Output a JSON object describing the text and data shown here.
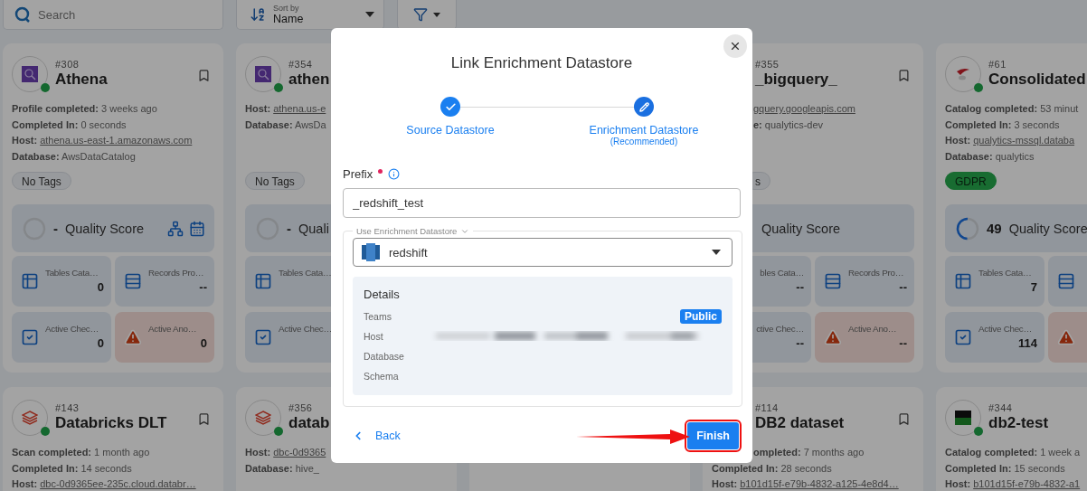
{
  "toolbar": {
    "search": {
      "placeholder": "Search"
    },
    "sort": {
      "label": "Sort by",
      "value": "Name"
    }
  },
  "cards": [
    {
      "number": "#308",
      "name": "Athena",
      "logo": {
        "kind": "athena"
      },
      "online": true,
      "bookmark": true,
      "lines": [
        {
          "label": "Profile completed:",
          "value": "3 weeks ago",
          "link": false
        },
        {
          "label": "Completed In:",
          "value": "0 seconds",
          "link": false
        },
        {
          "label": "Host:",
          "value": "athena.us-east-1.amazonaws.com",
          "link": true
        },
        {
          "label": "Database:",
          "value": "AwsDataCatalog",
          "link": false
        }
      ],
      "tags": [
        {
          "text": "No Tags",
          "kind": "empty"
        }
      ],
      "quality": {
        "score": "-",
        "label": "Quality Score",
        "icons": [
          {
            "kind": "hierarchy"
          },
          {
            "kind": "calendar"
          }
        ]
      },
      "stats": [
        {
          "kind": "tables",
          "label": "Tables Cata…",
          "value": "0"
        },
        {
          "kind": "records",
          "label": "Records Pro…",
          "value": "--"
        },
        {
          "kind": "checks",
          "label": "Active Chec…",
          "value": "0"
        },
        {
          "kind": "anomalies",
          "label": "Active Ano…",
          "value": "0"
        }
      ]
    },
    {
      "number": "#354",
      "name": "athen",
      "logo": {
        "kind": "athena"
      },
      "online": true,
      "lines": [
        {
          "label": "Host:",
          "value": "athena.us-e",
          "link": true
        },
        {
          "label": "Database:",
          "value": "AwsDa",
          "link": false
        }
      ],
      "tags": [
        {
          "text": "No Tags",
          "kind": "empty"
        }
      ],
      "quality": {
        "score": "-",
        "label": "Quali"
      },
      "stats": [
        {
          "kind": "tables",
          "label": "Tables Cata…"
        },
        {
          "kind": "checks",
          "label": "Active Chec…"
        }
      ]
    },
    {
      "number": "#355",
      "name": "_bigquery_",
      "bookmark": true,
      "lines": [
        {
          "value": "gquery.googleapis.com",
          "link": true
        },
        {
          "label": "e:",
          "value": "qualytics-dev",
          "link": false
        }
      ],
      "tags": [
        {
          "text": "s",
          "kind": "empty"
        }
      ],
      "quality": {
        "label": "Quality Score"
      },
      "stats": [
        {
          "kind": "tables",
          "label": "bles Cata…",
          "value": "--"
        },
        {
          "kind": "records",
          "label": "Records Pro…",
          "value": "--"
        },
        {
          "kind": "checks",
          "label": "ctive Chec…",
          "value": "--"
        },
        {
          "kind": "anomalies",
          "label": "Active Ano…",
          "value": "--"
        }
      ]
    },
    {
      "number": "#61",
      "name": "Consolidated",
      "logo": {
        "kind": "mssql"
      },
      "online": true,
      "lines": [
        {
          "label": "Catalog completed:",
          "value": "53 minut",
          "link": false
        },
        {
          "label": "Completed In:",
          "value": "3 seconds",
          "link": false
        },
        {
          "label": "Host:",
          "value": "qualytics-mssql.databa",
          "link": true
        },
        {
          "label": "Database:",
          "value": "qualytics",
          "link": false
        }
      ],
      "tags": [
        {
          "text": "GDPR",
          "kind": "tag"
        }
      ],
      "quality": {
        "score": "49",
        "label": "Quality Score",
        "level": 0.49
      },
      "stats": [
        {
          "kind": "tables",
          "label": "Tables Cata…",
          "value": "7"
        },
        {
          "kind": "records"
        },
        {
          "kind": "checks",
          "label": "Active Chec…",
          "value": "114"
        },
        {
          "kind": "anomalies"
        }
      ]
    },
    {
      "number": "#143",
      "name": "Databricks DLT",
      "logo": {
        "kind": "databricks"
      },
      "online": true,
      "bookmark": true,
      "lines": [
        {
          "label": "Scan completed:",
          "value": "1 month ago",
          "link": false
        },
        {
          "label": "Completed In:",
          "value": "14 seconds",
          "link": false
        },
        {
          "label": "Host:",
          "value": "dbc-0d9365ee-235c.cloud.databr…",
          "link": true
        }
      ]
    },
    {
      "number": "#356",
      "name": "datab",
      "logo": {
        "kind": "databricks"
      },
      "online": true,
      "lines": [
        {
          "label": "Host:",
          "value": "dbc-0d9365",
          "link": true
        },
        {
          "label": "Database:",
          "value": "hive_",
          "link": false
        }
      ]
    },
    {
      "number": "#114",
      "name": "DB2 dataset",
      "bookmark": true,
      "lines": [
        {
          "label": "ompleted:",
          "value": "7 months ago",
          "link": false
        },
        {
          "label": "Completed In:",
          "value": "28 seconds",
          "link": false
        },
        {
          "label": "Host:",
          "value": "b101d15f-e79b-4832-a125-4e8d4…",
          "link": true
        }
      ]
    },
    {
      "number": "#344",
      "name": "db2-test",
      "logo": {
        "kind": "db2"
      },
      "online": true,
      "lines": [
        {
          "label": "Catalog completed:",
          "value": "1 week a",
          "link": false
        },
        {
          "label": "Completed In:",
          "value": "15 seconds",
          "link": false
        },
        {
          "label": "Host:",
          "value": "b101d15f-e79b-4832-a1",
          "link": true
        }
      ]
    }
  ],
  "modal": {
    "title": "Link Enrichment Datastore",
    "steps": [
      {
        "label": "Source Datastore",
        "completed": true
      },
      {
        "label": "Enrichment Datastore",
        "note": "(Recommended)",
        "completed": false
      }
    ],
    "prefix": {
      "label": "Prefix",
      "required": true,
      "value": "_redshift_test"
    },
    "enrichment": {
      "legend": "Use Enrichment Datastore",
      "datastore": "redshift",
      "details_title": "Details",
      "details": [
        {
          "label": "Teams",
          "badge": "Public"
        },
        {
          "label": "Host",
          "redacted": true
        },
        {
          "label": "Database"
        },
        {
          "label": "Schema"
        }
      ]
    },
    "back": "Back",
    "finish": "Finish",
    "finish_highlighted": true
  }
}
